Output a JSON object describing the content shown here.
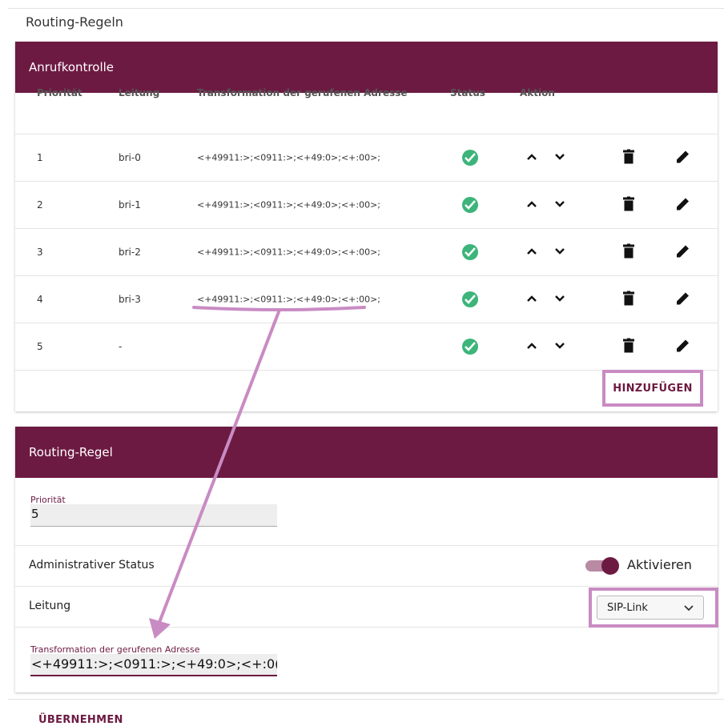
{
  "page": {
    "title": "Routing-Regeln"
  },
  "call_control": {
    "header": "Anrufkontrolle",
    "columns": {
      "priority": "Priorität",
      "line": "Leitung",
      "transform": "Transformation der gerufenen Adresse",
      "status": "Status",
      "action": "Aktion"
    },
    "rows": [
      {
        "priority": "1",
        "line": "bri-0",
        "transform": "<+49911:>;<0911:>;<+49:0>;<+:00>;",
        "status": "active"
      },
      {
        "priority": "2",
        "line": "bri-1",
        "transform": "<+49911:>;<0911:>;<+49:0>;<+:00>;",
        "status": "active"
      },
      {
        "priority": "3",
        "line": "bri-2",
        "transform": "<+49911:>;<0911:>;<+49:0>;<+:00>;",
        "status": "active"
      },
      {
        "priority": "4",
        "line": "bri-3",
        "transform": "<+49911:>;<0911:>;<+49:0>;<+:00>;",
        "status": "active"
      },
      {
        "priority": "5",
        "line": "-",
        "transform": "",
        "status": "active"
      }
    ],
    "add_label": "HINZUFÜGEN"
  },
  "routing_rule": {
    "header": "Routing-Regel",
    "priority_label": "Priorität",
    "priority_value": "5",
    "admin_status_label": "Administrativer Status",
    "admin_status_value": "Aktivieren",
    "line_label": "Leitung",
    "line_value": "SIP-Link",
    "transform_label": "Transformation der gerufenen Adresse",
    "transform_value": "<+49911:>;<0911:>;<+49:0>;<+:0("
  },
  "apply_label": "ÜBERNEHMEN",
  "colors": {
    "brand": "#6d1a42",
    "highlight": "#c98bc3",
    "status_ok": "#3cb47a"
  }
}
